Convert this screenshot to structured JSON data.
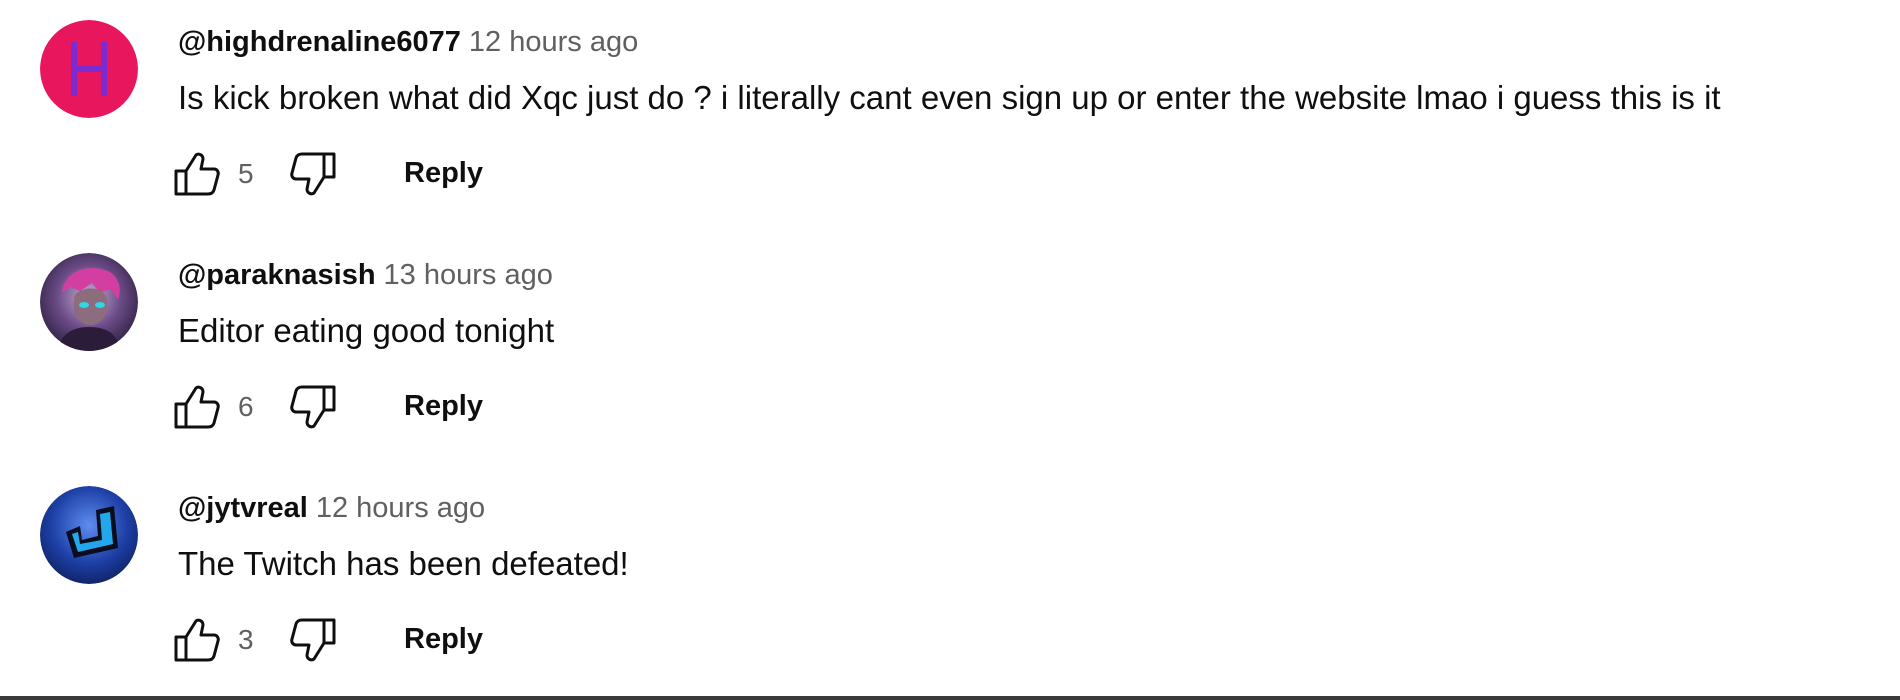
{
  "comments": [
    {
      "author": "@highdrenaline6077",
      "time": "12 hours ago",
      "text": "Is kick broken what did Xqc just do ? i literally cant even sign up or enter the website lmao i guess this is it",
      "likes": "5",
      "reply_label": "Reply",
      "avatar": {
        "type": "letter",
        "letter": "H",
        "bg": "#e8175d",
        "fg": "#7b2bd0"
      }
    },
    {
      "author": "@paraknasish",
      "time": "13 hours ago",
      "text": "Editor eating good tonight",
      "likes": "6",
      "reply_label": "Reply",
      "avatar": {
        "type": "image",
        "bg": "#5a3b6e"
      }
    },
    {
      "author": "@jytvreal",
      "time": "12 hours ago",
      "text": "The Twitch has been defeated!",
      "likes": "3",
      "reply_label": "Reply",
      "avatar": {
        "type": "image",
        "bg": "#1d3fa6"
      }
    }
  ],
  "icons": {
    "like": "thumbs-up-icon",
    "dislike": "thumbs-down-icon"
  },
  "colors": {
    "text": "#0f0f0f",
    "secondary_text": "#606060"
  }
}
